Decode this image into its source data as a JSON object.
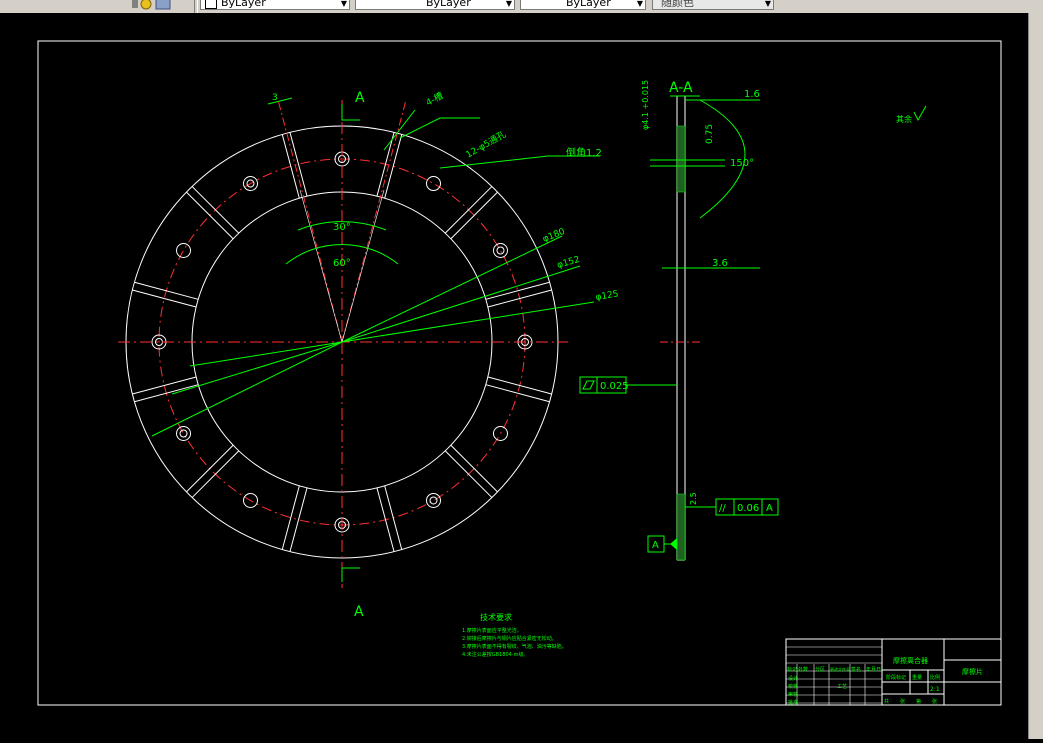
{
  "toolbar": {
    "layer_combo": "ByLayer",
    "linetype_combo": "ByLayer",
    "lineweight_combo": "ByLayer",
    "plotstyle_combo": "随颜色"
  },
  "drawing": {
    "section_label_top": "A",
    "section_label_bottom": "A",
    "section_title": "A-A",
    "dim_slot_width": "3",
    "dim_4_slots": "4-槽",
    "dim_holes": "12-φ5通孔",
    "dim_chamfer": "倒角1.2",
    "dim_phi_outer": "φ180",
    "dim_phi_mid": "φ152",
    "dim_phi_inner": "φ125",
    "angle_30": "30°",
    "angle_60": "60°",
    "dim_thickness": "1.6",
    "dim_depth": "0.75",
    "angle_150": "150°",
    "dim_3_6": "3.6",
    "dim_vert_left": "φ4.1 +0.015",
    "flatness_value": "0.025",
    "parallel_value": "0.06",
    "parallel_datum": "A",
    "datum_label": "A",
    "dim_bottom_small": "2.5",
    "roughness_note": "其余"
  },
  "notes": {
    "title": "技术要求",
    "lines": [
      "1.摩擦片表面应平整光洁。",
      "2.铆接后摩擦片与钢片应贴合紧密无松动。",
      "3.摩擦片表面不得有裂纹、气泡、油污等缺陷。",
      "4.未注公差按GB1804-m级。"
    ]
  },
  "title_block": {
    "company": "摩擦离合器",
    "part_name": "摩擦片",
    "scale": "2:1",
    "row_labels": [
      "标记",
      "处数",
      "分区",
      "更改文件号",
      "签名",
      "年月日"
    ],
    "side_labels": [
      "设计",
      "校核",
      "审核",
      "工艺",
      "批准"
    ],
    "stage_labels": [
      "阶段标记",
      "重量",
      "比例"
    ],
    "sheet_labels": [
      "共",
      "张",
      "第",
      "张"
    ]
  }
}
